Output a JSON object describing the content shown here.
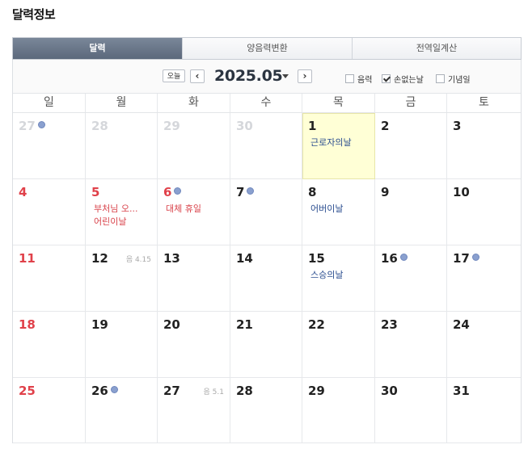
{
  "title": "달력정보",
  "tabs": [
    {
      "label": "달력",
      "active": true
    },
    {
      "label": "양음력변환",
      "active": false
    },
    {
      "label": "전역일계산",
      "active": false
    }
  ],
  "toolbar": {
    "today_label": "오늘",
    "prev_icon": "‹",
    "next_icon": "›",
    "month_label": "2025.05",
    "options": [
      {
        "label": "음력",
        "checked": false
      },
      {
        "label": "손없는날",
        "checked": true
      },
      {
        "label": "기념일",
        "checked": false
      }
    ]
  },
  "weekdays": [
    "일",
    "월",
    "화",
    "수",
    "목",
    "금",
    "토"
  ],
  "colors": {
    "holiday_red": "#e0414a",
    "event_blue": "#2a4d8f",
    "dot_blue": "#8aa0cf",
    "today_bg": "#ffffd6",
    "tab_active": "#5b687b"
  },
  "days": [
    {
      "day": "27",
      "tone": "gray",
      "dot": true
    },
    {
      "day": "28",
      "tone": "gray"
    },
    {
      "day": "29",
      "tone": "gray"
    },
    {
      "day": "30",
      "tone": "gray"
    },
    {
      "day": "1",
      "today": true,
      "events": [
        {
          "text": "근로자의날",
          "color": "blue"
        }
      ]
    },
    {
      "day": "2"
    },
    {
      "day": "3"
    },
    {
      "day": "4",
      "tone": "red"
    },
    {
      "day": "5",
      "tone": "red",
      "events": [
        {
          "text": "부처님 오...",
          "color": "red"
        },
        {
          "text": "어린이날",
          "color": "red"
        }
      ]
    },
    {
      "day": "6",
      "tone": "red",
      "dot": true,
      "events": [
        {
          "text": "대체 휴일",
          "color": "red"
        }
      ]
    },
    {
      "day": "7",
      "dot": true
    },
    {
      "day": "8",
      "events": [
        {
          "text": "어버이날",
          "color": "blue"
        }
      ]
    },
    {
      "day": "9"
    },
    {
      "day": "10"
    },
    {
      "day": "11",
      "tone": "red"
    },
    {
      "day": "12",
      "lunar": "음 4.15"
    },
    {
      "day": "13"
    },
    {
      "day": "14"
    },
    {
      "day": "15",
      "events": [
        {
          "text": "스승의날",
          "color": "blue"
        }
      ]
    },
    {
      "day": "16",
      "dot": true
    },
    {
      "day": "17",
      "dot": true
    },
    {
      "day": "18",
      "tone": "red"
    },
    {
      "day": "19"
    },
    {
      "day": "20"
    },
    {
      "day": "21"
    },
    {
      "day": "22"
    },
    {
      "day": "23"
    },
    {
      "day": "24"
    },
    {
      "day": "25",
      "tone": "red"
    },
    {
      "day": "26",
      "dot": true
    },
    {
      "day": "27",
      "lunar": "음 5.1"
    },
    {
      "day": "28"
    },
    {
      "day": "29"
    },
    {
      "day": "30"
    },
    {
      "day": "31"
    }
  ]
}
